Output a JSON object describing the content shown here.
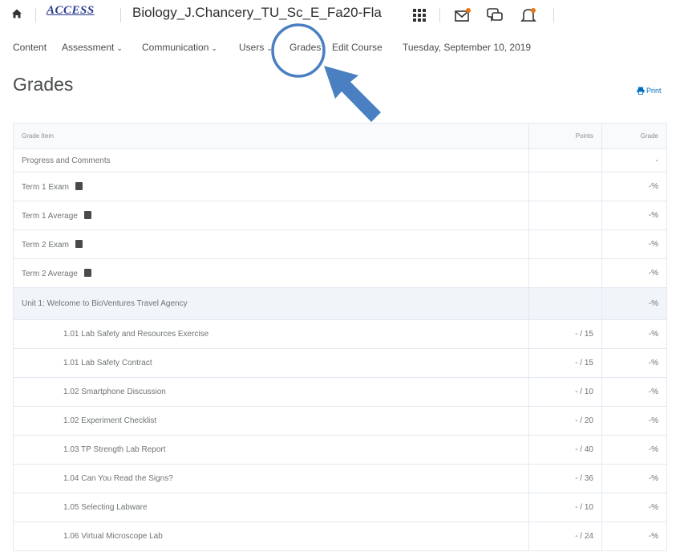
{
  "topbar": {
    "logo_text": "ACCESS",
    "course_title": "Biology_J.Chancery_TU_Sc_E_Fa20-Fla",
    "icons": [
      "home-icon",
      "waffle-icon",
      "mail-icon",
      "chat-icon",
      "bell-icon"
    ]
  },
  "nav": {
    "items": [
      {
        "label": "Content",
        "has_menu": false
      },
      {
        "label": "Assessment",
        "has_menu": true
      },
      {
        "label": "Communication",
        "has_menu": true
      },
      {
        "label": "Users",
        "has_menu": true
      },
      {
        "label": "Grades",
        "has_menu": false
      },
      {
        "label": "Edit Course",
        "has_menu": false
      }
    ],
    "date": "Tuesday, September 10, 2019"
  },
  "page": {
    "title": "Grades",
    "print_label": "Print"
  },
  "table": {
    "headers": {
      "item": "Grade Item",
      "points": "Points",
      "grade": "Grade"
    },
    "rows": [
      {
        "name": "Progress and Comments",
        "points": "",
        "grade": "-",
        "type": "first",
        "calc": false
      },
      {
        "name": "Term 1 Exam",
        "points": "",
        "grade": "-%",
        "type": "top",
        "calc": true
      },
      {
        "name": "Term 1 Average",
        "points": "",
        "grade": "-%",
        "type": "top",
        "calc": true
      },
      {
        "name": "Term 2 Exam",
        "points": "",
        "grade": "-%",
        "type": "top",
        "calc": true
      },
      {
        "name": "Term 2 Average",
        "points": "",
        "grade": "-%",
        "type": "top",
        "calc": true
      },
      {
        "name": "Unit 1: Welcome to BioVentures Travel Agency",
        "points": "",
        "grade": "-%",
        "type": "unit",
        "calc": false
      },
      {
        "name": "1.01 Lab Safety and Resources Exercise",
        "points": "- / 15",
        "grade": "-%",
        "type": "child",
        "calc": false
      },
      {
        "name": "1.01 Lab Safety Contract",
        "points": "- / 15",
        "grade": "-%",
        "type": "child",
        "calc": false
      },
      {
        "name": "1.02 Smartphone Discussion",
        "points": "- / 10",
        "grade": "-%",
        "type": "child",
        "calc": false
      },
      {
        "name": "1.02 Experiment Checklist",
        "points": "- / 20",
        "grade": "-%",
        "type": "child",
        "calc": false
      },
      {
        "name": "1.03 TP Strength Lab Report",
        "points": "- / 40",
        "grade": "-%",
        "type": "child",
        "calc": false
      },
      {
        "name": "1.04 Can You Read the Signs?",
        "points": "- / 36",
        "grade": "-%",
        "type": "child",
        "calc": false
      },
      {
        "name": "1.05 Selecting Labware",
        "points": "- / 10",
        "grade": "-%",
        "type": "child",
        "calc": false
      },
      {
        "name": "1.06 Virtual Microscope Lab",
        "points": "- / 24",
        "grade": "-%",
        "type": "child",
        "calc": false
      }
    ]
  },
  "annotation": {
    "circle_color": "#4a7fc1",
    "arrow_color": "#4a7fc1",
    "target": "Grades"
  }
}
